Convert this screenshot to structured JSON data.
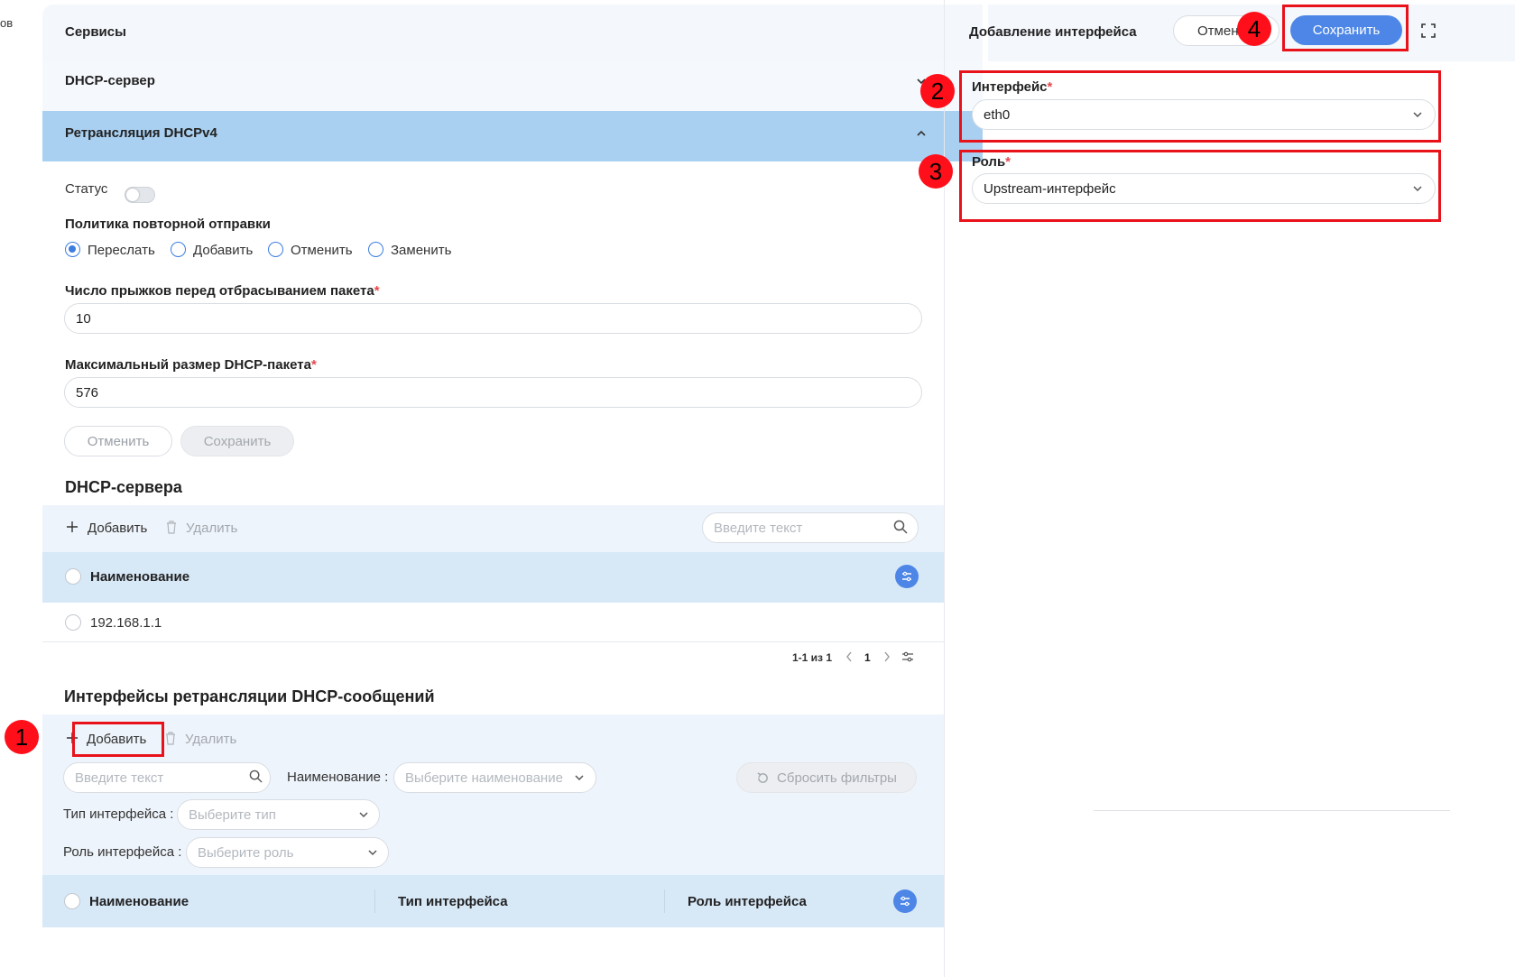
{
  "left_stub": "ов",
  "main": {
    "title": "Сервисы",
    "dhcp_server_section": "DHCP-сервер",
    "relay_section": "Ретрансляция DHCPv4",
    "status_label": "Статус",
    "policy": {
      "label": "Политика повторной отправки",
      "options": [
        "Переслать",
        "Добавить",
        "Отменить",
        "Заменить"
      ],
      "selected": "Переслать"
    },
    "hops": {
      "label": "Число прыжков перед отбрасыванием пакета",
      "required": "*",
      "value": "10"
    },
    "max_size": {
      "label": "Максимальный размер DHCP-пакета",
      "required": "*",
      "value": "576"
    },
    "form_cancel": "Отменить",
    "form_save": "Сохранить",
    "servers": {
      "heading": "DHCP-сервера",
      "add": "Добавить",
      "delete": "Удалить",
      "search_placeholder": "Введите текст",
      "column_name": "Наименование",
      "rows": [
        "192.168.1.1"
      ],
      "pagination": {
        "range": "1-1 из 1",
        "page": "1"
      }
    },
    "interfaces": {
      "heading": "Интерфейсы ретрансляции DHCP-сообщений",
      "add": "Добавить",
      "delete": "Удалить",
      "search_placeholder": "Введите текст",
      "filter_name_label": "Наименование",
      "filter_name_placeholder": "Выберите наименование",
      "reset_filters": "Сбросить фильтры",
      "filter_type_label": "Тип интерфейса",
      "filter_type_placeholder": "Выберите тип",
      "filter_role_label": "Роль интерфейса",
      "filter_role_placeholder": "Выберите роль",
      "columns": [
        "Наименование",
        "Тип интерфейса",
        "Роль интерфейса"
      ]
    }
  },
  "drawer": {
    "title": "Добавление интерфейса",
    "cancel": "Отмен",
    "save": "Сохранить",
    "interface": {
      "label": "Интерфейс",
      "required": "*",
      "value": "eth0"
    },
    "role": {
      "label": "Роль",
      "required": "*",
      "value": "Upstream-интерфейс"
    }
  },
  "annotations": [
    "1",
    "2",
    "3",
    "4"
  ],
  "colors": {
    "accent": "#4d86e6",
    "highlight_band": "#a9d0f1",
    "annotation_red": "#e8121a"
  }
}
